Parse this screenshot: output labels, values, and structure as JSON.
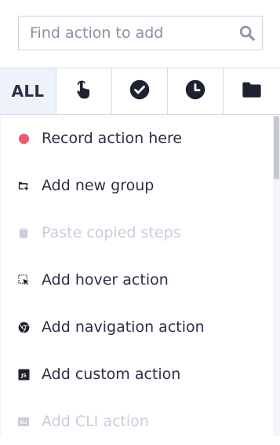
{
  "search": {
    "placeholder": "Find action to add",
    "value": ""
  },
  "filters": {
    "all_label": "ALL",
    "tabs": [
      {
        "icon": "tap-hand-icon"
      },
      {
        "icon": "check-circle-icon"
      },
      {
        "icon": "clock-icon"
      },
      {
        "icon": "folder-icon"
      }
    ]
  },
  "actions": [
    {
      "label": "Record action here",
      "icon": "record-dot-icon",
      "enabled": true,
      "color": "#ef5b6e"
    },
    {
      "label": "Add new group",
      "icon": "add-folder-icon",
      "enabled": true
    },
    {
      "label": "Paste copied steps",
      "icon": "clipboard-icon",
      "enabled": false
    },
    {
      "label": "Add hover action",
      "icon": "hover-cursor-icon",
      "enabled": true
    },
    {
      "label": "Add navigation action",
      "icon": "browser-icon",
      "enabled": true
    },
    {
      "label": "Add custom action",
      "icon": "js-icon",
      "enabled": true
    },
    {
      "label": "Add CLI action",
      "icon": "cli-icon",
      "enabled": false
    }
  ],
  "colors": {
    "text": "#2a2f45",
    "disabled_text": "#c9cdda",
    "active_tab_bg": "#eef2fa",
    "border": "#d6d9e2",
    "record": "#ef5b6e"
  }
}
